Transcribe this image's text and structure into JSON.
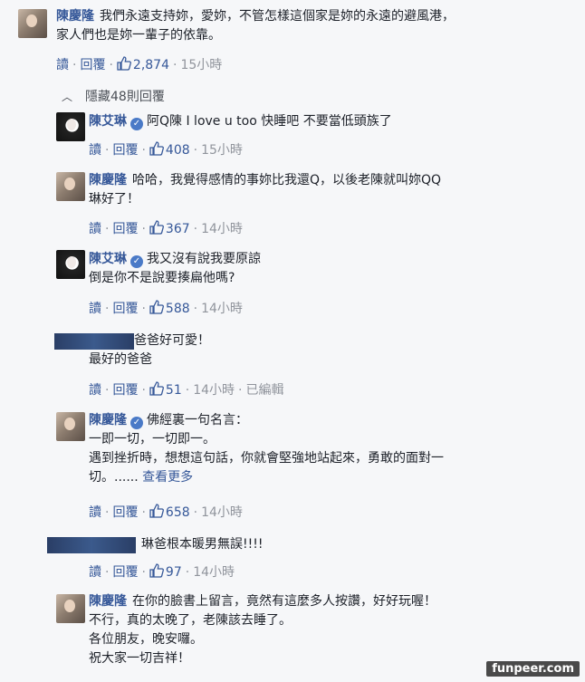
{
  "icons": {
    "like": "thumbs-up-icon",
    "verified": "verified-check-icon",
    "collapse": "chevron-up-icon"
  },
  "colors": {
    "link": "#365899",
    "meta": "#90949c",
    "background": "#f6f7f9"
  },
  "top_comment": {
    "author": "陳慶隆",
    "lines": [
      "我們永遠支持妳，愛妳，不管怎樣這個家是妳的永遠的避風港，",
      "家人們也是妳一輩子的依靠。"
    ],
    "read_label": "讀",
    "reply_label": "回覆",
    "likes": "2,874",
    "time": "15小時"
  },
  "hidden_replies_label": "隱藏48則回覆",
  "replies": [
    {
      "author": "陳艾琳",
      "verified": true,
      "lines": [
        "阿Q陳 I love u too 快睡吧 不要當低頭族了"
      ],
      "likes": "408",
      "time": "15小時"
    },
    {
      "author": "陳慶隆",
      "verified": false,
      "lines": [
        "哈哈，我覺得感情的事妳比我還Q，以後老陳就叫妳QQ",
        "琳好了！"
      ],
      "likes": "367",
      "time": "14小時"
    },
    {
      "author": "陳艾琳",
      "verified": true,
      "lines": [
        "我又沒有說我要原諒",
        "倒是你不是說要揍扁他嗎?"
      ],
      "likes": "588",
      "time": "14小時"
    },
    {
      "author": "",
      "verified": false,
      "lines": [
        "爸爸好可愛！",
        "最好的爸爸"
      ],
      "likes": "51",
      "time": "14小時",
      "edited": "已編輯"
    },
    {
      "author": "陳慶隆",
      "verified": true,
      "lines": [
        "佛經裏一句名言：",
        "一即一切，一切即一。",
        "遇到挫折時，想想這句話，你就會堅強地站起來，勇敢的面對一",
        "切。......"
      ],
      "see_more": "查看更多",
      "likes": "658",
      "time": "14小時"
    },
    {
      "author": "",
      "verified": false,
      "lines": [
        "琳爸根本暖男無誤!!!!"
      ],
      "likes": "97",
      "time": "14小時"
    },
    {
      "author": "陳慶隆",
      "verified": false,
      "lines": [
        "在你的臉書上留言，竟然有這麼多人按讚，好好玩喔！",
        "不行，真的太晚了，老陳該去睡了。",
        "各位朋友，晚安囉。",
        "祝大家一切吉祥！"
      ]
    }
  ],
  "actions": {
    "read": "讀",
    "reply": "回覆"
  },
  "watermark": "funpeer.com"
}
